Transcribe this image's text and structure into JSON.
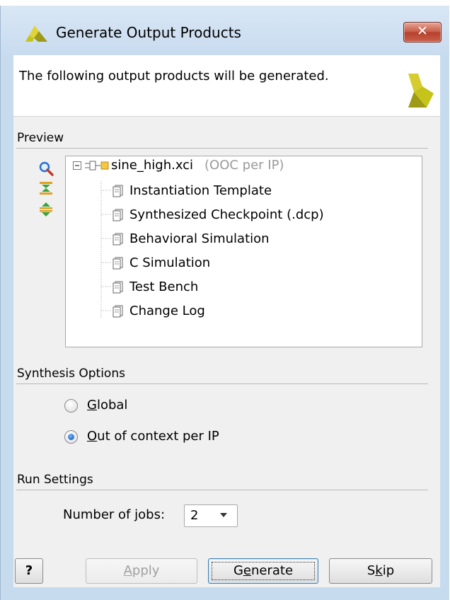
{
  "window": {
    "title": "Generate Output Products",
    "close_label": "✕",
    "header_text": "The following output products will be generated."
  },
  "preview": {
    "label": "Preview",
    "tools": [
      "search-icon",
      "collapse-all-icon",
      "expand-all-icon"
    ],
    "root": {
      "name": "sine_high.xci",
      "note": "(OOC per IP)"
    },
    "items": [
      "Instantiation Template",
      "Synthesized Checkpoint (.dcp)",
      "Behavioral Simulation",
      "C Simulation",
      "Test Bench",
      "Change Log"
    ]
  },
  "synthesis": {
    "label": "Synthesis Options",
    "options": [
      {
        "mnemonic": "G",
        "rest": "lobal",
        "selected": false
      },
      {
        "mnemonic": "O",
        "rest": "ut of context per IP",
        "selected": true
      }
    ]
  },
  "run": {
    "label": "Run Settings",
    "jobs_pre": "Number of ",
    "jobs_mnemonic": "j",
    "jobs_post": "obs:",
    "jobs_value": "2"
  },
  "buttons": {
    "help": "?",
    "apply_mnemonic": "A",
    "apply_rest": "pply",
    "generate_pre": "G",
    "generate_mnemonic": "e",
    "generate_post": "nerate",
    "skip_pre": "S",
    "skip_mnemonic": "k",
    "skip_post": "ip"
  },
  "colors": {
    "titlebar": "#c8dbef",
    "close_button": "#c75c48",
    "accent_logo": "#c6c41a",
    "muted_text": "#9a9a9a"
  }
}
